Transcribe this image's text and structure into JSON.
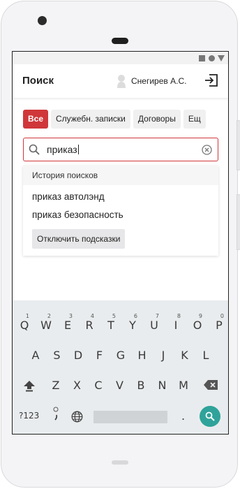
{
  "appbar": {
    "title": "Поиск",
    "user_name": "Снегирев А.С."
  },
  "chips": [
    {
      "label": "Все",
      "active": true
    },
    {
      "label": "Служебн. записки",
      "active": false
    },
    {
      "label": "Договоры",
      "active": false
    },
    {
      "label": "Ещ",
      "active": false
    }
  ],
  "search": {
    "value": "приказ"
  },
  "suggestions": {
    "header": "История поисков",
    "items": [
      "приказ автолэнд",
      "приказ безопасность"
    ],
    "disable_button": "Отключить подсказки"
  },
  "keyboard": {
    "row1": [
      [
        "Q",
        "1"
      ],
      [
        "W",
        "2"
      ],
      [
        "E",
        "3"
      ],
      [
        "R",
        "4"
      ],
      [
        "T",
        "5"
      ],
      [
        "Y",
        "6"
      ],
      [
        "U",
        "7"
      ],
      [
        "I",
        "8"
      ],
      [
        "O",
        "9"
      ],
      [
        "P",
        "0"
      ]
    ],
    "row2": [
      "A",
      "S",
      "D",
      "F",
      "G",
      "H",
      "J",
      "K",
      "L"
    ],
    "row3": [
      "Z",
      "X",
      "C",
      "V",
      "B",
      "N",
      "M"
    ],
    "symbols_label": "?123",
    "dot_label": "."
  },
  "colors": {
    "accent": "#d0373a",
    "search_key": "#2fa39a"
  }
}
